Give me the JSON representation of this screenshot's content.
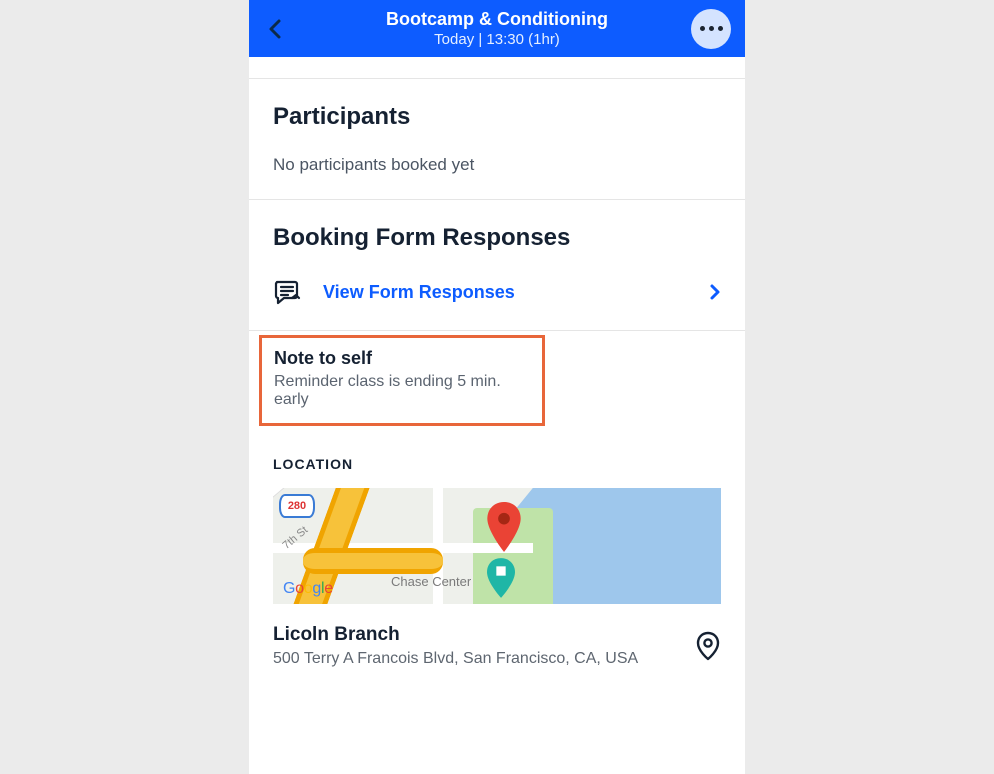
{
  "header": {
    "title": "Bootcamp & Conditioning",
    "subtitle": "Today | 13:30 (1hr)"
  },
  "participants": {
    "heading": "Participants",
    "empty_text": "No participants booked yet"
  },
  "booking": {
    "heading": "Booking Form Responses",
    "link_label": "View Form Responses"
  },
  "note": {
    "title": "Note to self",
    "text": "Reminder class is ending 5 min. early"
  },
  "location": {
    "label": "LOCATION",
    "name": "Licoln Branch",
    "address": "500 Terry A Francois Blvd, San Francisco, CA, USA",
    "map_highway": "280",
    "map_street": "7th St",
    "map_landmark": "Chase Center",
    "map_attrib": "Google"
  }
}
